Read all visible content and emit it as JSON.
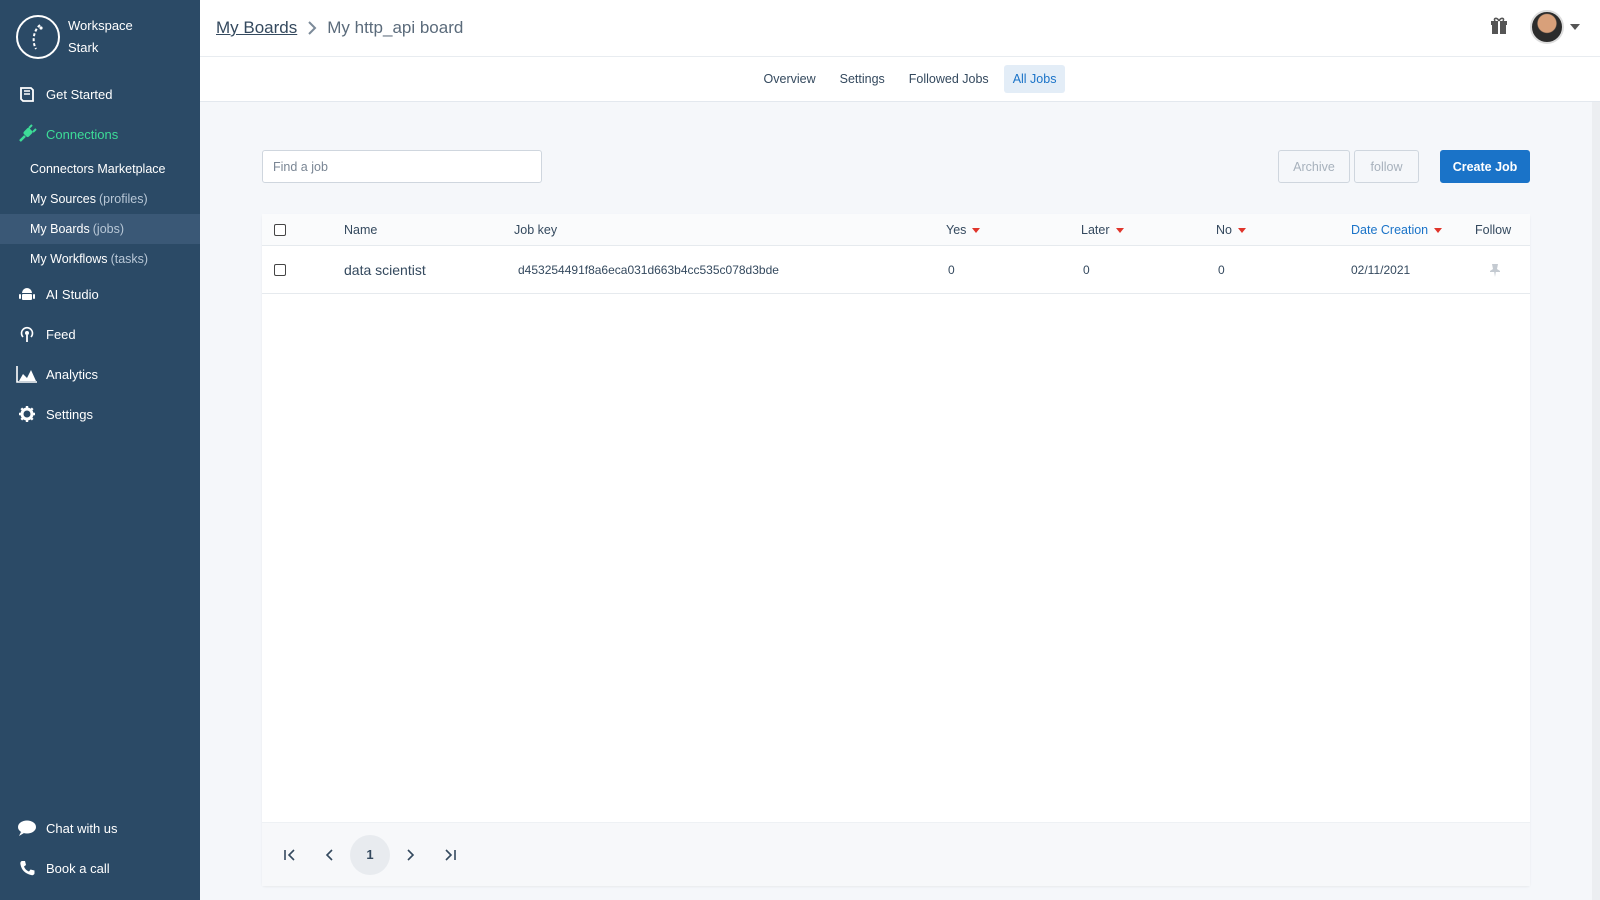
{
  "sidebar": {
    "workspace_line1": "Workspace",
    "workspace_line2": "Stark",
    "nav": {
      "get_started": "Get Started",
      "connections": "Connections",
      "ai_studio": "AI Studio",
      "feed": "Feed",
      "analytics": "Analytics",
      "settings": "Settings"
    },
    "sub_items": [
      {
        "label": "Connectors Marketplace",
        "hint": ""
      },
      {
        "label": "My Sources",
        "hint": "(profiles)"
      },
      {
        "label": "My Boards",
        "hint": "(jobs)"
      },
      {
        "label": "My Workflows",
        "hint": "(tasks)"
      }
    ],
    "bottom": {
      "chat": "Chat with us",
      "book": "Book a call"
    },
    "active_color": "#3ddc97"
  },
  "header": {
    "breadcrumb_root": "My Boards",
    "breadcrumb_current": "My http_api board"
  },
  "tabs": [
    "Overview",
    "Settings",
    "Followed Jobs",
    "All Jobs"
  ],
  "active_tab": "All Jobs",
  "toolbar": {
    "search_placeholder": "Find a job",
    "archive_label": "Archive",
    "follow_label": "follow",
    "create_label": "Create Job",
    "primary_color": "#1a73c8"
  },
  "table": {
    "columns": {
      "name": "Name",
      "job_key": "Job key",
      "yes": "Yes",
      "later": "Later",
      "no": "No",
      "date_creation": "Date Creation",
      "follow": "Follow"
    },
    "rows": [
      {
        "name": "data scientist",
        "job_key": "d453254491f8a6eca031d663b4cc535c078d3bde",
        "yes": "0",
        "later": "0",
        "no": "0",
        "date_creation": "02/11/2021"
      }
    ]
  },
  "pagination": {
    "current_page": "1"
  }
}
